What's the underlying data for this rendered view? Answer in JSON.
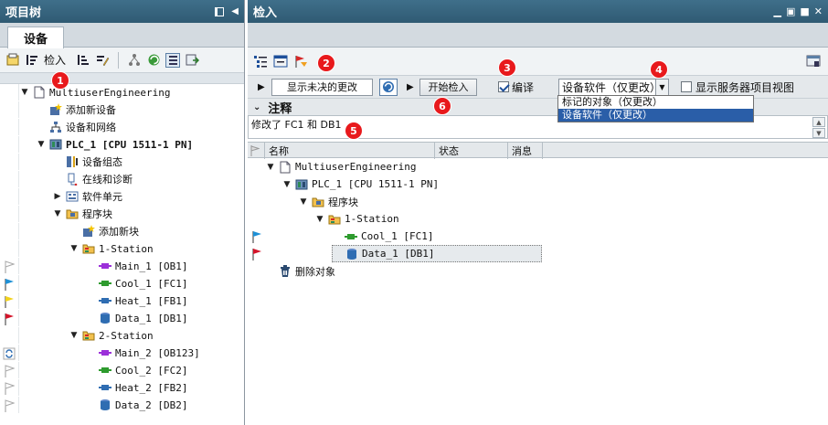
{
  "left": {
    "title": "项目树",
    "tab": "设备",
    "toolbar": {
      "import_label": "检入"
    },
    "tree": [
      {
        "label": "MultiuserEngineering",
        "indent": 0,
        "arrow": "down",
        "icon": "project-icon",
        "flag": ""
      },
      {
        "label": "添加新设备",
        "indent": 1,
        "arrow": "",
        "icon": "add-device-icon",
        "flag": ""
      },
      {
        "label": "设备和网络",
        "indent": 1,
        "arrow": "",
        "icon": "network-icon",
        "flag": ""
      },
      {
        "label": "PLC_1 [CPU 1511-1 PN]",
        "indent": 1,
        "arrow": "down",
        "icon": "plc-icon",
        "flag": "",
        "bold": true
      },
      {
        "label": "设备组态",
        "indent": 2,
        "arrow": "",
        "icon": "device-config-icon",
        "flag": ""
      },
      {
        "label": "在线和诊断",
        "indent": 2,
        "arrow": "",
        "icon": "diagnostics-icon",
        "flag": ""
      },
      {
        "label": "软件单元",
        "indent": 2,
        "arrow": "right",
        "icon": "software-unit-icon",
        "flag": ""
      },
      {
        "label": "程序块",
        "indent": 2,
        "arrow": "down",
        "icon": "folder-icon",
        "flag": ""
      },
      {
        "label": "添加新块",
        "indent": 3,
        "arrow": "",
        "icon": "add-block-icon",
        "flag": ""
      },
      {
        "label": "1-Station",
        "indent": 3,
        "arrow": "down",
        "icon": "group-folder-icon",
        "flag": ""
      },
      {
        "label": "Main_1 [OB1]",
        "indent": 4,
        "arrow": "",
        "icon": "ob-icon",
        "flag": "white-flag"
      },
      {
        "label": "Cool_1 [FC1]",
        "indent": 4,
        "arrow": "",
        "icon": "fc-icon",
        "flag": "blue-flag"
      },
      {
        "label": "Heat_1 [FB1]",
        "indent": 4,
        "arrow": "",
        "icon": "fb-icon",
        "flag": "yellow-flag"
      },
      {
        "label": "Data_1 [DB1]",
        "indent": 4,
        "arrow": "",
        "icon": "db-icon",
        "flag": "red-flag"
      },
      {
        "label": "2-Station",
        "indent": 3,
        "arrow": "down",
        "icon": "group-folder-icon",
        "flag": ""
      },
      {
        "label": "Main_2 [OB123]",
        "indent": 4,
        "arrow": "",
        "icon": "ob-icon",
        "flag": "sync-icon"
      },
      {
        "label": "Cool_2 [FC2]",
        "indent": 4,
        "arrow": "",
        "icon": "fc-icon",
        "flag": "white-flag"
      },
      {
        "label": "Heat_2 [FB2]",
        "indent": 4,
        "arrow": "",
        "icon": "fb-icon",
        "flag": "white-flag"
      },
      {
        "label": "Data_2 [DB2]",
        "indent": 4,
        "arrow": "",
        "icon": "db-icon",
        "flag": "white-flag"
      }
    ]
  },
  "right": {
    "title": "检入",
    "show_pending_label": "显示未决的更改",
    "start_checkin_label": "开始检入",
    "compile_label": "编译",
    "compile_checked": true,
    "select_value": "设备软件（仅更改）",
    "dropdown_options": [
      "标记的对象（仅更改）",
      "设备软件（仅更改）"
    ],
    "show_server_view_label": "显示服务器项目视图",
    "notes_label": "注释",
    "notes_text": "修改了 FC1 和 DB1",
    "columns": {
      "name": "名称",
      "status": "状态",
      "message": "消息"
    },
    "rows": [
      {
        "label": "MultiuserEngineering",
        "indent": 0,
        "arrow": "down",
        "icon": "project-icon",
        "flag": ""
      },
      {
        "label": "PLC_1 [CPU 1511-1 PN]",
        "indent": 1,
        "arrow": "down",
        "icon": "plc-icon",
        "flag": ""
      },
      {
        "label": "程序块",
        "indent": 2,
        "arrow": "down",
        "icon": "folder-icon",
        "flag": ""
      },
      {
        "label": "1-Station",
        "indent": 3,
        "arrow": "down",
        "icon": "group-folder-icon",
        "flag": ""
      },
      {
        "label": "Cool_1 [FC1]",
        "indent": 4,
        "arrow": "",
        "icon": "fc-icon",
        "flag": "blue-flag"
      },
      {
        "label": "Data_1 [DB1]",
        "indent": 4,
        "arrow": "",
        "icon": "db-icon",
        "flag": "red-flag",
        "selected": true
      },
      {
        "label": "删除对象",
        "indent": 0,
        "arrow": "",
        "icon": "trash-icon",
        "flag": ""
      }
    ]
  },
  "badges": [
    "1",
    "2",
    "3",
    "4",
    "5",
    "6"
  ],
  "colors": {
    "title_bar": "#2f5a73",
    "badge": "#e8191c",
    "selection": "#2a5ea8"
  }
}
